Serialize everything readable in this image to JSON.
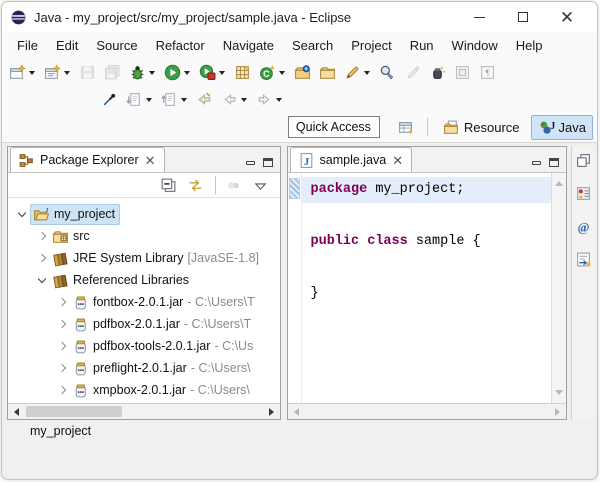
{
  "window": {
    "title": "Java - my_project/src/my_project/sample.java - Eclipse",
    "controls": {
      "minimize": "minimize",
      "maximize": "maximize",
      "close": "✕"
    }
  },
  "menu": {
    "items": [
      "File",
      "Edit",
      "Source",
      "Refactor",
      "Navigate",
      "Search",
      "Project",
      "Run",
      "Window",
      "Help"
    ]
  },
  "toolbar": {
    "row1": [
      {
        "name": "new",
        "icon": "newfile",
        "dd": true
      },
      {
        "name": "new-wizard",
        "icon": "newwiz",
        "dd": true
      },
      {
        "name": "save",
        "icon": "save",
        "disabled": true
      },
      {
        "name": "save-all",
        "icon": "saveall",
        "disabled": true
      },
      {
        "name": "debug",
        "icon": "debug",
        "dd": true
      },
      {
        "name": "run",
        "icon": "run",
        "dd": true
      },
      {
        "name": "coverage",
        "icon": "coverage",
        "dd": true
      },
      {
        "name": "new-java-project",
        "icon": "javaproj"
      },
      {
        "name": "new-class",
        "icon": "newclass",
        "dd": true
      },
      {
        "name": "open-task",
        "icon": "taskfolder"
      },
      {
        "name": "open-folder",
        "icon": "folder"
      },
      {
        "name": "annotation-pen",
        "icon": "pen",
        "dd": true
      },
      {
        "name": "search",
        "icon": "search"
      },
      {
        "name": "mark-occurrences",
        "icon": "markocc",
        "disabled": true
      },
      {
        "name": "open-type",
        "icon": "opentype"
      },
      {
        "name": "pin-editor",
        "icon": "sq1"
      },
      {
        "name": "show-whitespace",
        "icon": "sq2"
      }
    ],
    "row2": [
      {
        "name": "link-with-selection",
        "icon": "pin"
      },
      {
        "name": "next-annotation",
        "icon": "nextann",
        "dd": true
      },
      {
        "name": "previous-annotation",
        "icon": "prevann",
        "dd": true
      },
      {
        "name": "last-edit-location",
        "icon": "lastedit"
      },
      {
        "name": "back",
        "icon": "back",
        "dd": true
      },
      {
        "name": "forward",
        "icon": "fwd",
        "dd": true
      }
    ]
  },
  "quick_access": {
    "label": "Quick Access"
  },
  "perspectives": {
    "open_perspective_icon": "openpersp",
    "buttons": [
      {
        "name": "resource",
        "icon": "respersp",
        "label": "Resource",
        "active": false
      },
      {
        "name": "java",
        "icon": "javapersp",
        "label": "Java",
        "active": true
      }
    ]
  },
  "package_explorer": {
    "title": "Package Explorer",
    "tab_icon": "pe",
    "toolbar": [
      {
        "name": "collapse-all",
        "icon": "collapseall"
      },
      {
        "name": "link-with-editor",
        "icon": "linkeditor"
      },
      {
        "name": "separator",
        "sep": true
      },
      {
        "name": "focus-on-active-task",
        "icon": "focustask",
        "disabled": true
      },
      {
        "name": "view-menu",
        "icon": "viewmenu"
      }
    ],
    "tree": [
      {
        "level": 0,
        "expander": "down",
        "icon": "projfolder",
        "label": "my_project",
        "suffix": "",
        "selected": true
      },
      {
        "level": 1,
        "expander": "right",
        "icon": "srcpkg",
        "label": "src",
        "suffix": ""
      },
      {
        "level": 1,
        "expander": "right",
        "icon": "library",
        "label": "JRE System Library",
        "suffix": " [JavaSE-1.8]"
      },
      {
        "level": 1,
        "expander": "down",
        "icon": "library",
        "label": "Referenced Libraries",
        "suffix": ""
      },
      {
        "level": 2,
        "expander": "right",
        "icon": "jar",
        "label": "fontbox-2.0.1.jar",
        "suffix": " - C:\\Users\\T"
      },
      {
        "level": 2,
        "expander": "right",
        "icon": "jar",
        "label": "pdfbox-2.0.1.jar",
        "suffix": " - C:\\Users\\T"
      },
      {
        "level": 2,
        "expander": "right",
        "icon": "jar",
        "label": "pdfbox-tools-2.0.1.jar",
        "suffix": " - C:\\Us"
      },
      {
        "level": 2,
        "expander": "right",
        "icon": "jar",
        "label": "preflight-2.0.1.jar",
        "suffix": " - C:\\Users\\"
      },
      {
        "level": 2,
        "expander": "right",
        "icon": "jar",
        "label": "xmpbox-2.0.1.jar",
        "suffix": " - C:\\Users\\"
      }
    ]
  },
  "editor": {
    "tab": {
      "label": "sample.java",
      "icon": "jfile"
    },
    "lines": [
      {
        "current": true,
        "tokens": [
          {
            "t": "package",
            "kw": true
          },
          {
            "t": " my_project;"
          }
        ]
      },
      {
        "tokens": []
      },
      {
        "current": false,
        "tokens": [
          {
            "t": "public",
            "kw": true
          },
          {
            "t": " "
          },
          {
            "t": "class",
            "kw": true
          },
          {
            "t": " sample {"
          }
        ]
      },
      {
        "tokens": []
      },
      {
        "current": false,
        "tokens": [
          {
            "t": "}"
          }
        ]
      }
    ]
  },
  "right_strip": [
    {
      "name": "restore-views",
      "icon": "restore"
    },
    {
      "name": "task-list",
      "icon": "tasklist"
    },
    {
      "name": "javadoc",
      "icon": "javadoc"
    },
    {
      "name": "declaration",
      "icon": "declaration"
    }
  ],
  "statusbar": {
    "text": "my_project"
  },
  "colors": {
    "accent_selection": "#cde4f7",
    "keyword": "#7f0055",
    "perspective_active_bg": "#cfe4f7",
    "current_line": "#e4eefa"
  }
}
